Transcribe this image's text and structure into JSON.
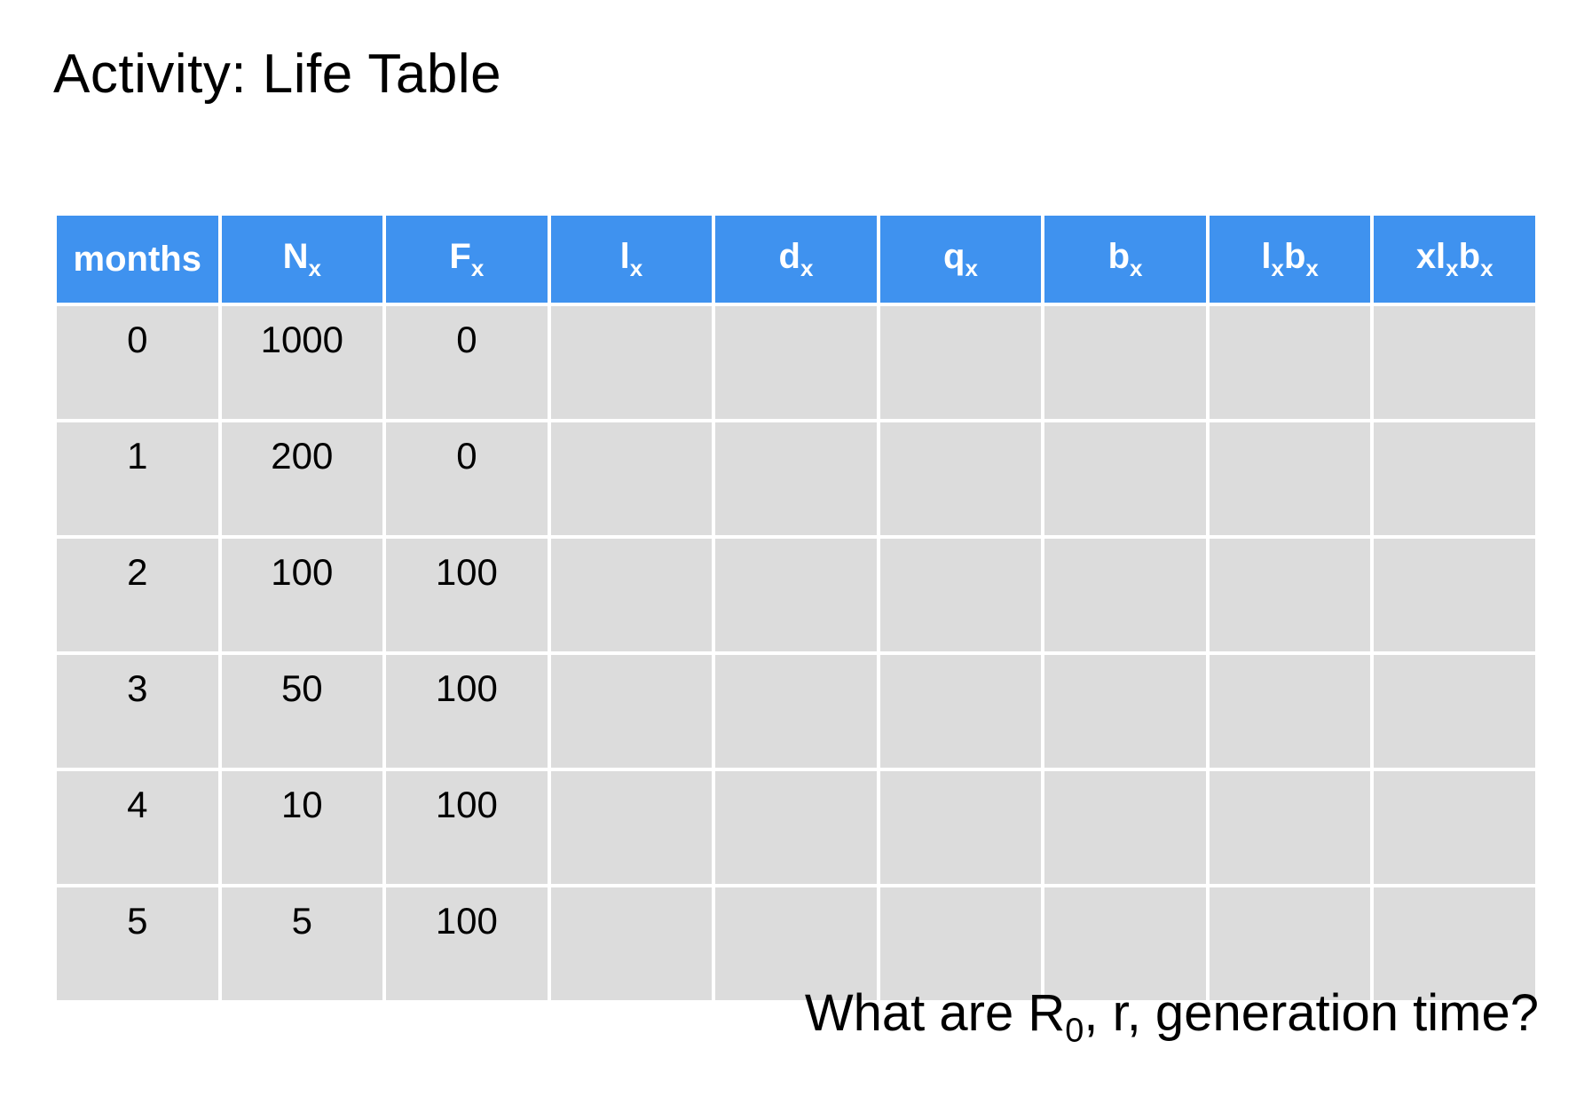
{
  "title": "Activity: Life Table",
  "table": {
    "headers": [
      {
        "main": "months",
        "sub": ""
      },
      {
        "main": "N",
        "sub": "x"
      },
      {
        "main": "F",
        "sub": "x"
      },
      {
        "main": "l",
        "sub": "x"
      },
      {
        "main": "d",
        "sub": "x"
      },
      {
        "main": "q",
        "sub": "x"
      },
      {
        "main": "b",
        "sub": "x"
      },
      {
        "main": "l",
        "sub": "x",
        "main2": "b",
        "sub2": "x"
      },
      {
        "main": "xl",
        "sub": "x",
        "main2": "b",
        "sub2": "x"
      }
    ],
    "rows": [
      {
        "months": "0",
        "Nx": "1000",
        "Fx": "0",
        "lx": "",
        "dx": "",
        "qx": "",
        "bx": "",
        "lxbx": "",
        "xlxbx": ""
      },
      {
        "months": "1",
        "Nx": "200",
        "Fx": "0",
        "lx": "",
        "dx": "",
        "qx": "",
        "bx": "",
        "lxbx": "",
        "xlxbx": ""
      },
      {
        "months": "2",
        "Nx": "100",
        "Fx": "100",
        "lx": "",
        "dx": "",
        "qx": "",
        "bx": "",
        "lxbx": "",
        "xlxbx": ""
      },
      {
        "months": "3",
        "Nx": "50",
        "Fx": "100",
        "lx": "",
        "dx": "",
        "qx": "",
        "bx": "",
        "lxbx": "",
        "xlxbx": ""
      },
      {
        "months": "4",
        "Nx": "10",
        "Fx": "100",
        "lx": "",
        "dx": "",
        "qx": "",
        "bx": "",
        "lxbx": "",
        "xlxbx": ""
      },
      {
        "months": "5",
        "Nx": "5",
        "Fx": "100",
        "lx": "",
        "dx": "",
        "qx": "",
        "bx": "",
        "lxbx": "",
        "xlxbx": ""
      }
    ]
  },
  "question": {
    "prefix": "What are R",
    "sub": "0",
    "suffix": ", r, generation time?"
  },
  "chart_data": {
    "type": "table",
    "title": "Activity: Life Table",
    "columns": [
      "months",
      "N_x",
      "F_x",
      "l_x",
      "d_x",
      "q_x",
      "b_x",
      "l_x b_x",
      "x l_x b_x"
    ],
    "rows": [
      [
        0,
        1000,
        0,
        null,
        null,
        null,
        null,
        null,
        null
      ],
      [
        1,
        200,
        0,
        null,
        null,
        null,
        null,
        null,
        null
      ],
      [
        2,
        100,
        100,
        null,
        null,
        null,
        null,
        null,
        null
      ],
      [
        3,
        50,
        100,
        null,
        null,
        null,
        null,
        null,
        null
      ],
      [
        4,
        10,
        100,
        null,
        null,
        null,
        null,
        null,
        null
      ],
      [
        5,
        5,
        100,
        null,
        null,
        null,
        null,
        null,
        null
      ]
    ],
    "prompt": "What are R_0, r, generation time?"
  }
}
